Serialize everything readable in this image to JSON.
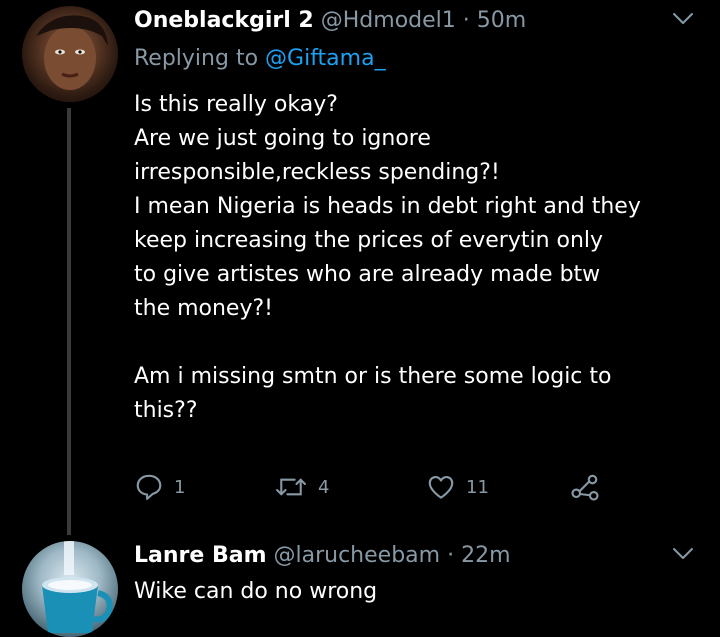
{
  "tweets": [
    {
      "display_name": "Oneblackgirl 2",
      "handle": "@Hdmodel1",
      "separator": "·",
      "time": "50m",
      "replying_prefix": "Replying to ",
      "replying_to": "@Giftama_",
      "body": [
        "Is this really okay?",
        "Are we just going to ignore",
        "irresponsible,reckless spending?!",
        "I mean Nigeria is heads in debt right and they",
        "keep increasing the prices of everytin only",
        "to give artistes who are already made btw",
        "the money?!",
        "Am i missing smtn or is there some logic to",
        "this??"
      ],
      "actions": {
        "reply_count": "1",
        "retweet_count": "4",
        "like_count": "11"
      }
    },
    {
      "display_name": "Lanre Bam",
      "handle": "@larucheebam",
      "separator": "·",
      "time": "22m",
      "body": [
        "Wike can do no wrong"
      ]
    }
  ],
  "icons": {
    "caret": "chevron-down-icon",
    "reply": "reply-icon",
    "retweet": "retweet-icon",
    "like": "heart-icon",
    "share": "share-icon"
  },
  "colors": {
    "background": "#000000",
    "text_primary": "#ffffff",
    "text_secondary": "#8899a6",
    "link": "#1da1f2",
    "thread_line": "#3a3a3a"
  }
}
